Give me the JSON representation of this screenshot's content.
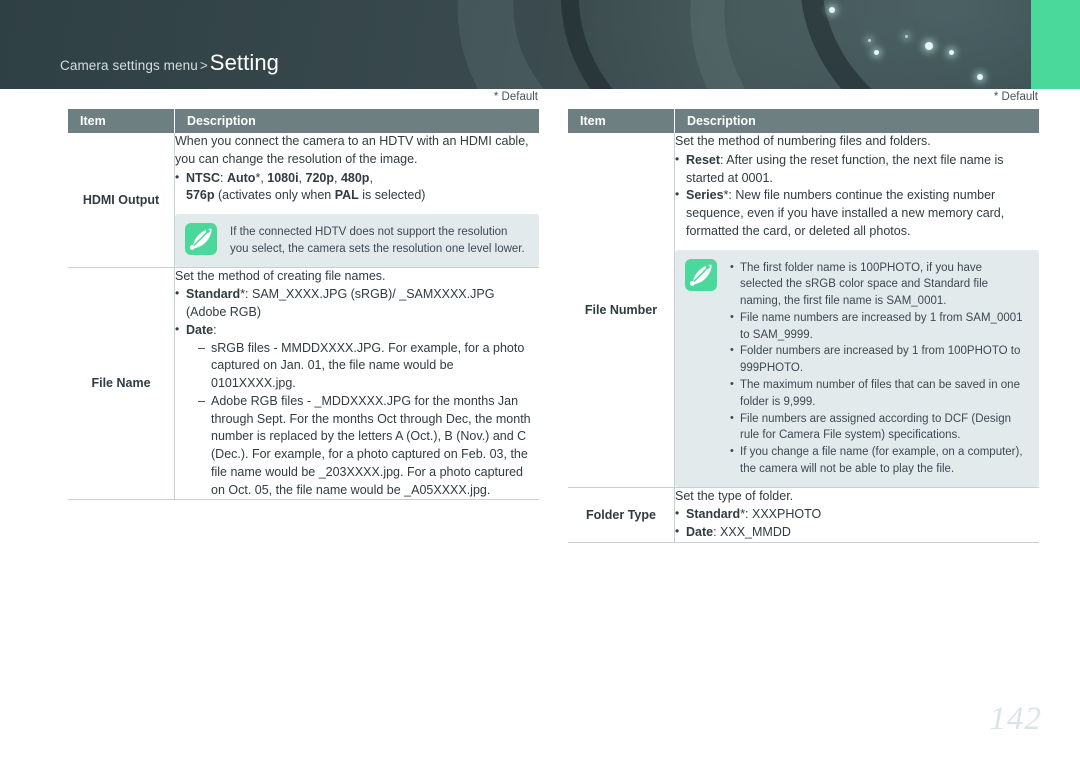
{
  "header": {
    "breadcrumb_prefix": "Camera settings menu",
    "breadcrumb_separator": ">",
    "title": "Setting",
    "accent_color": "#4bd99b",
    "background_color": "#36474b"
  },
  "default_marker": "* Default",
  "table_columns": {
    "item": "Item",
    "description": "Description"
  },
  "left_table": {
    "rows": [
      {
        "item": "HDMI Output",
        "lead": "When you connect the camera to an HDTV with an HDMI cable, you can change the resolution of the image.",
        "bullets": [
          "NTSC: Auto*, 1080i, 720p, 480p, 576p (activates only when PAL is selected)"
        ],
        "note": "If the connected HDTV does not support the resolution you select, the camera sets the resolution one level lower."
      },
      {
        "item": "File Name",
        "lead": "Set the method of creating file names.",
        "bullets": [
          "Standard*: SAM_XXXX.JPG (sRGB)/ _SAMXXXX.JPG (Adobe RGB)",
          "Date:"
        ],
        "sub_bullets": [
          "sRGB files - MMDDXXXX.JPG. For example, for a photo captured on Jan. 01, the file name would be 0101XXXX.jpg.",
          "Adobe RGB files - _MDDXXXX.JPG for the months Jan through Sept. For the months Oct through Dec, the month number is replaced by the letters A (Oct.), B (Nov.) and C (Dec.). For example, for a photo captured on Feb. 03, the file name would be _203XXXX.jpg. For a photo captured on Oct. 05, the file name would be _A05XXXX.jpg."
        ]
      }
    ]
  },
  "right_table": {
    "rows": [
      {
        "item": "File Number",
        "lead": "Set the method of numbering files and folders.",
        "bullets": [
          "Reset: After using the reset function, the next file name is started at 0001.",
          "Series*: New file numbers continue the existing number sequence, even if you have installed a new memory card, formatted the card, or deleted all photos."
        ],
        "note_bullets": [
          "The first folder name is 100PHOTO, if you have selected the sRGB color space and Standard file naming, the first file name is SAM_0001.",
          "File name numbers are increased by 1 from SAM_0001 to SAM_9999.",
          "Folder numbers are increased by 1 from 100PHOTO to 999PHOTO.",
          "The maximum number of files that can be saved in one folder is 9,999.",
          "File numbers are assigned according to DCF (Design rule for Camera File system) specifications.",
          "If you change a file name (for example, on a computer), the camera will not be able to play the file."
        ]
      },
      {
        "item": "Folder Type",
        "lead": "Set the type of folder.",
        "bullets": [
          "Standard*: XXXPHOTO",
          "Date: XXX_MMDD"
        ]
      }
    ]
  },
  "page_number": "142"
}
